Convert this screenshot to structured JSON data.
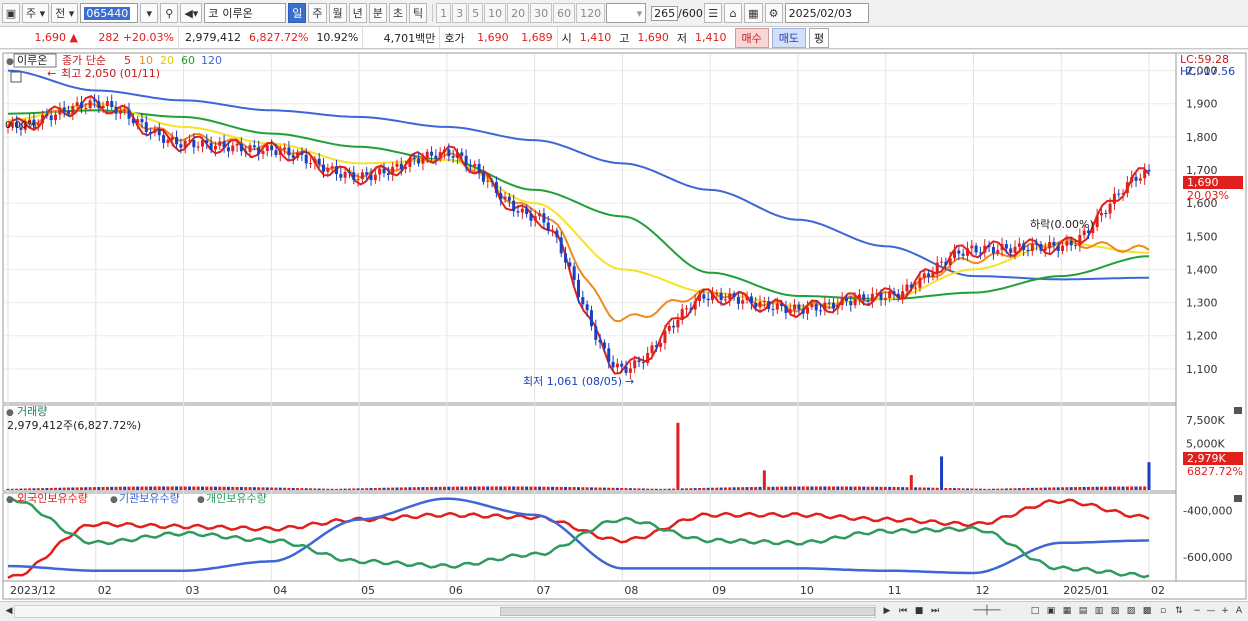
{
  "toolbar": {
    "market_label": "주",
    "prev_label": "전",
    "stock_code": "065440",
    "code_label": "코",
    "stock_name": "이루온",
    "periods": [
      "일",
      "주",
      "월",
      "년",
      "분",
      "초",
      "틱"
    ],
    "active_period": "일",
    "intervals": [
      "1",
      "3",
      "5",
      "10",
      "20",
      "30",
      "60",
      "120"
    ],
    "count_value": "265",
    "count_total": "/600",
    "date_value": "2025/02/03"
  },
  "quote": {
    "price": "1,690",
    "change": "282",
    "change_pct": "+20.03%",
    "volume": "2,979,412",
    "volume_ratio": "6,827.72%",
    "turnover_ratio": "10.92%",
    "amount": "4,701백만",
    "ask_label": "호가",
    "ask": "1,690",
    "bid": "1,689",
    "open_label": "시",
    "open": "1,410",
    "high_label": "고",
    "high": "1,690",
    "low_label": "저",
    "low": "1,410",
    "buy_label": "매수",
    "sell_label": "매도",
    "eval_label": "평"
  },
  "colors": {
    "up": "#e0201c",
    "down": "#1a3fc1",
    "ma5": "#e0201c",
    "ma10": "#f08a1c",
    "ma20": "#f5e32a",
    "ma60": "#21a03a",
    "ma120": "#3e66d6",
    "foreign": "#e0201c",
    "institution": "#3e66d6",
    "individual": "#2e9a5e"
  },
  "price_panel": {
    "title": "이루온",
    "legend_prefix": "종가 단순",
    "ma_labels": [
      "5",
      "10",
      "20",
      "60",
      "120"
    ],
    "high_note": "최고 2,050 (01/11)",
    "low_note": "최저 1,061 (08/05)",
    "left_note": "0.00%",
    "dip_note": "하락(0.00%)",
    "lc_label": "LC:59.28",
    "hc_label": "HC:-17.56",
    "price_tag": "1,690",
    "pct_tag": "20.03%"
  },
  "volume_panel": {
    "title": "거래량",
    "summary": "2,979,412주(6,827.72%)",
    "tag_value": "2,979K",
    "tag_pct": "6827.72%"
  },
  "holdings_panel": {
    "legend": [
      "외국인보유수량",
      "기관보유수량",
      "개인보유수량"
    ]
  },
  "chart_data": [
    {
      "type": "line",
      "title": "",
      "x": [
        "2023/12",
        "02",
        "03",
        "04",
        "05",
        "06",
        "07",
        "08",
        "09",
        "10",
        "11",
        "12",
        "2025/01",
        "02"
      ],
      "ylabel": "",
      "ylim": [
        1000,
        2050
      ],
      "y_ticks": [
        "2,000",
        "1,900",
        "1,800",
        "1,700",
        "1,600",
        "1,500",
        "1,400",
        "1,300",
        "1,200",
        "1,100"
      ],
      "series": [
        {
          "name": "5",
          "values": [
            1830,
            1900,
            1780,
            1760,
            1680,
            1750,
            1560,
            1100,
            1320,
            1280,
            1320,
            1460,
            1470,
            1690
          ]
        },
        {
          "name": "10",
          "values": [
            1840,
            1890,
            1800,
            1770,
            1690,
            1740,
            1580,
            1250,
            1330,
            1285,
            1320,
            1430,
            1480,
            1460
          ]
        },
        {
          "name": "20",
          "values": [
            1850,
            1900,
            1830,
            1780,
            1720,
            1730,
            1600,
            1400,
            1330,
            1290,
            1310,
            1400,
            1480,
            1450
          ]
        },
        {
          "name": "60",
          "values": [
            1870,
            1880,
            1860,
            1810,
            1770,
            1730,
            1640,
            1560,
            1390,
            1320,
            1310,
            1330,
            1380,
            1440
          ]
        },
        {
          "name": "120",
          "values": [
            2000,
            1940,
            1910,
            1880,
            1860,
            1830,
            1790,
            1720,
            1640,
            1550,
            1470,
            1380,
            1370,
            1375
          ]
        }
      ]
    },
    {
      "type": "bar",
      "title": "거래량",
      "ylim": [
        0,
        9000000
      ],
      "y_ticks": [
        "7,500K",
        "5,000K"
      ],
      "last_value": 2979412
    },
    {
      "type": "line",
      "title": "",
      "ylim": [
        -700000,
        -330000
      ],
      "y_ticks": [
        "-400,000",
        "-600,000"
      ],
      "series": [
        {
          "name": "외국인보유수량",
          "values": [
            -690000,
            -460000,
            -470000,
            -480000,
            -440000,
            -420000,
            -430000,
            -530000,
            -420000,
            -420000,
            -440000,
            -460000,
            -360000,
            -430000
          ]
        },
        {
          "name": "기관보유수량",
          "values": [
            -640000,
            -660000,
            -660000,
            -620000,
            -440000,
            -350000,
            -420000,
            -650000,
            -650000,
            -650000,
            -660000,
            -670000,
            -540000,
            -530000
          ]
        },
        {
          "name": "개인보유수량",
          "values": [
            -350000,
            -540000,
            -500000,
            -530000,
            -620000,
            -640000,
            -590000,
            -440000,
            -530000,
            -540000,
            -490000,
            -480000,
            -650000,
            -680000
          ]
        }
      ]
    }
  ]
}
